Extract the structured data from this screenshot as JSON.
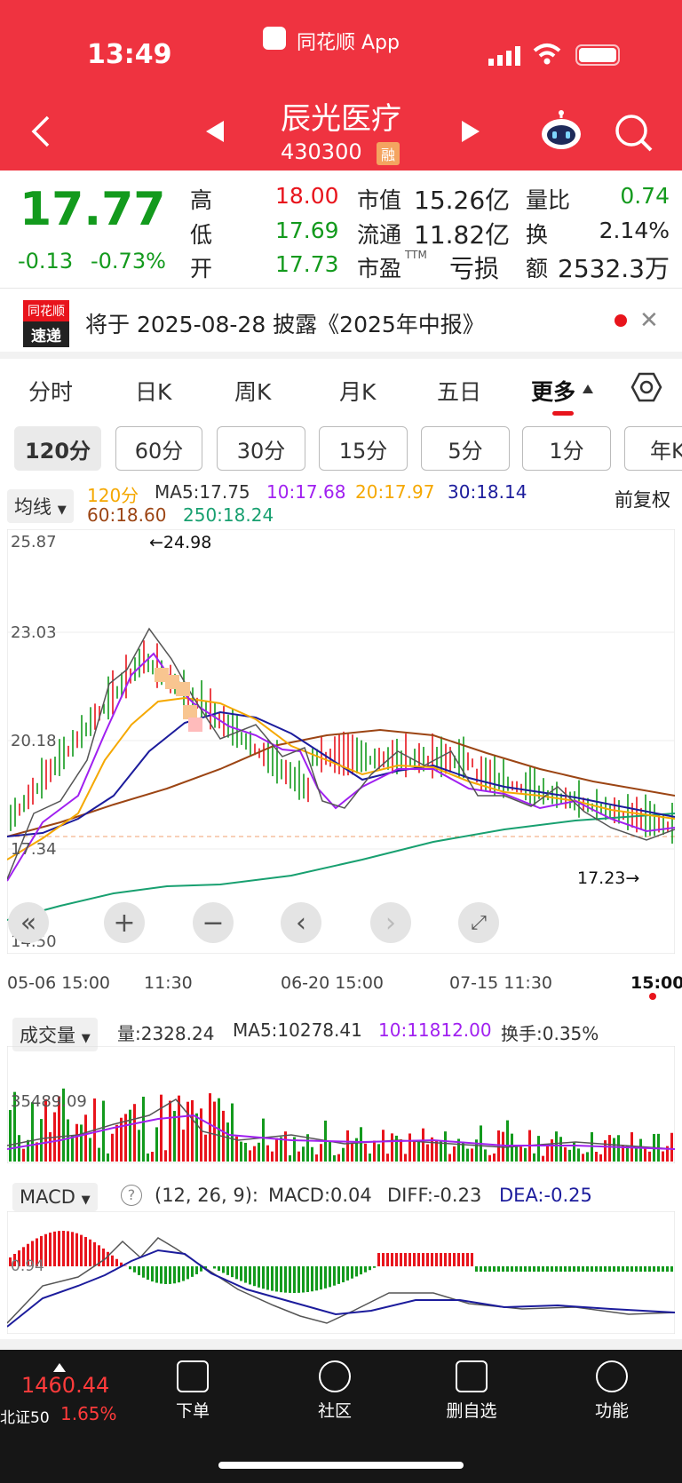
{
  "status_bar": {
    "time": "13:49",
    "app_name": "同花顺 App"
  },
  "header": {
    "stock_name": "辰光医疗",
    "stock_code": "430300",
    "badge": "融"
  },
  "quote": {
    "price": "17.77",
    "change": "-0.13",
    "change_pct": "-0.73%",
    "high_label": "高",
    "high": "18.00",
    "low_label": "低",
    "low": "17.69",
    "open_label": "开",
    "open": "17.73",
    "mktcap_label": "市值",
    "mktcap": "15.26亿",
    "float_label": "流通",
    "float": "11.82亿",
    "pe_label": "市盈",
    "pe_sup": "TTM",
    "pe": "亏损",
    "volratio_label": "量比",
    "volratio": "0.74",
    "turnover_label": "换",
    "turnover": "2.14%",
    "amount_label": "额",
    "amount": "2532.3万"
  },
  "news": {
    "logo_top": "同花顺",
    "logo_bottom": "速递",
    "text": "将于 2025-08-28 披露《2025年中报》"
  },
  "tabs": [
    "分时",
    "日K",
    "周K",
    "月K",
    "五日",
    "更多"
  ],
  "periods": [
    "120分",
    "60分",
    "30分",
    "15分",
    "5分",
    "1分",
    "年K"
  ],
  "ma_legend": {
    "selector": "均线",
    "period": "120分",
    "ma5": "MA5:17.75",
    "ma10": "10:17.68",
    "ma20": "20:17.97",
    "ma30": "30:18.14",
    "ma60": "60:18.60",
    "ma250": "250:18.24",
    "adjust": "前复权"
  },
  "price_axis": [
    "25.87",
    "23.03",
    "20.18",
    "17.34",
    "14.50"
  ],
  "annotations": {
    "high": "←24.98",
    "low": "17.23→"
  },
  "time_axis": [
    "05-06 15:00",
    "11:30",
    "06-20 15:00",
    "07-15 11:30",
    "15:00"
  ],
  "volume": {
    "selector": "成交量",
    "vol": "量:2328.24",
    "ma5": "MA5:10278.41",
    "ma10": "10:11812.00",
    "turnover": "换手:0.35%",
    "axis": "35489.09"
  },
  "macd": {
    "selector": "MACD",
    "params": "(12, 26, 9):",
    "macd": "MACD:0.04",
    "diff": "DIFF:-0.23",
    "dea": "DEA:-0.25",
    "axis": "0.94"
  },
  "bottom_nav": {
    "index_value": "1460.44",
    "index_name": "北证50",
    "index_pct": "1.65%",
    "items": [
      "下单",
      "社区",
      "删自选",
      "功能"
    ]
  },
  "colors": {
    "header": "#ef3340",
    "up": "#e8141c",
    "down": "#139a1d",
    "ma10": "#a020f0",
    "ma20": "#f5a800",
    "ma30": "#1c1c9c",
    "ma60": "#9c4514",
    "ma250": "#18a070"
  }
}
